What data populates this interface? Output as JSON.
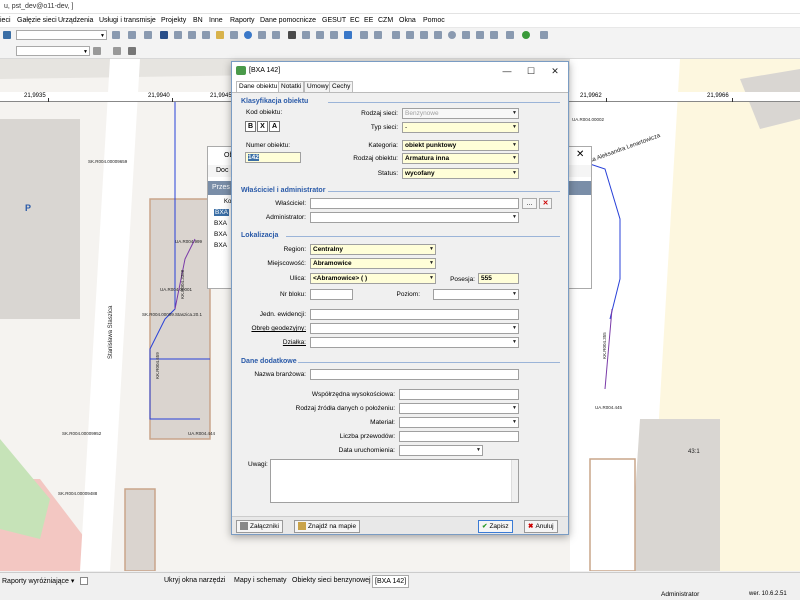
{
  "window": {
    "title": "u, pst_dev@o11-dev, ]"
  },
  "menu": [
    "ieci",
    "Gałęzie sieci",
    "Urządzenia",
    "Usługi i transmisje",
    "Projekty",
    "BN",
    "Inne",
    "Raporty",
    "Dane pomocnicze",
    "GESUT",
    "EC",
    "EE",
    "CZM",
    "Okna",
    "Pomoc"
  ],
  "ruler": [
    "21,9935",
    "21,9940",
    "21,9945",
    "21,9962",
    "21,9966"
  ],
  "map": {
    "streets": [
      "Stanisława Staszica",
      "eofila Aleksandra Lenartowicza"
    ],
    "labels": [
      "SK.R004.00009659",
      "SK.R004.00009952",
      "SK.R004.00009488",
      "UA.R004.999",
      "UA.R004.00001",
      "UA.R004.444",
      "UA.R004.445",
      "UA.R004.00002",
      "KK.R004.659",
      "KK.R004.3388",
      "SK.R004.00009.Staszica.20.1",
      "KK.R004.355",
      "43:1",
      "P"
    ],
    "colors": {
      "background": "#f5f3f0",
      "building": "#d9d6d2",
      "parcel": "#c9a58a",
      "yellow_area": "#fdf7df",
      "green_area": "#c6e3b8",
      "pink_area": "#f3c7c2",
      "network_blue": "#2840d8",
      "network_purple": "#7a3aa8"
    }
  },
  "bg_window": {
    "title": "Ob",
    "toolbar": "Doc",
    "header": "Przes",
    "rows": [
      "BXA",
      "BXA",
      "BXA",
      "BXA"
    ],
    "col": "Koo"
  },
  "dialog": {
    "title": "[BXA 142]",
    "tabs": [
      "Dane obiektu",
      "Notatki",
      "Umowy",
      "Cechy"
    ],
    "sections": {
      "klasyfikacja": "Klasyfikacja obiektu",
      "wlasciciel": "Właściciel i administrator",
      "lokalizacja": "Lokalizacja",
      "dodatkowe": "Dane dodatkowe"
    },
    "fields": {
      "kod_obiektu_label": "Kod obiektu:",
      "kod_buttons": [
        "B",
        "X",
        "A"
      ],
      "numer_obiektu_label": "Numer obiektu:",
      "numer_obiektu": "142",
      "rodzaj_sieci_label": "Rodzaj sieci:",
      "rodzaj_sieci": "Benzynowe",
      "typ_sieci_label": "Typ sieci:",
      "typ_sieci": "-",
      "kategoria_label": "Kategoria:",
      "kategoria": "obiekt punktowy",
      "rodzaj_obiektu_label": "Rodzaj obiektu:",
      "rodzaj_obiektu": "Armatura inna",
      "status_label": "Status:",
      "status": "wycofany",
      "wlasciciel_label": "Właściciel:",
      "wlasciciel": "",
      "administrator_label": "Administrator:",
      "administrator": "",
      "browse_btn": "...",
      "region_label": "Region:",
      "region": "Centralny",
      "miejscowosc_label": "Miejscowość:",
      "miejscowosc": "Abramowice",
      "ulica_label": "Ulica:",
      "ulica": "<Abramowice> ( )",
      "posesja_label": "Posesja:",
      "posesja": "555",
      "nr_bloku_label": "Nr bloku:",
      "poziom_label": "Poziom:",
      "jedn_label": "Jedn. ewidencji:",
      "obreb_label": "Obręb geodezyjny:",
      "dzialka_label": "Działka:",
      "nazwa_branzowa_label": "Nazwa branżowa:",
      "wspolrzedna_label": "Współrzędna wysokościowa:",
      "zrodlo_label": "Rodzaj źródła danych o położeniu:",
      "material_label": "Materiał:",
      "liczba_label": "Liczba przewodów:",
      "data_label": "Data uruchomienia:",
      "uwagi_label": "Uwagi:"
    },
    "footer": {
      "zalaczniki": "Załączniki",
      "znajdz": "Znajdź na mapie",
      "zapisz": "Zapisz",
      "anuluj": "Anuluj"
    }
  },
  "statusbar": {
    "reports": "Raporty wyróżniające",
    "tabs": [
      "Ukryj okna narzędzi",
      "Mapy i schematy",
      "Obiekty sieci benzynowej",
      "[BXA 142]"
    ],
    "user": "Administrator",
    "version": "wer. 10.6.2.51"
  }
}
